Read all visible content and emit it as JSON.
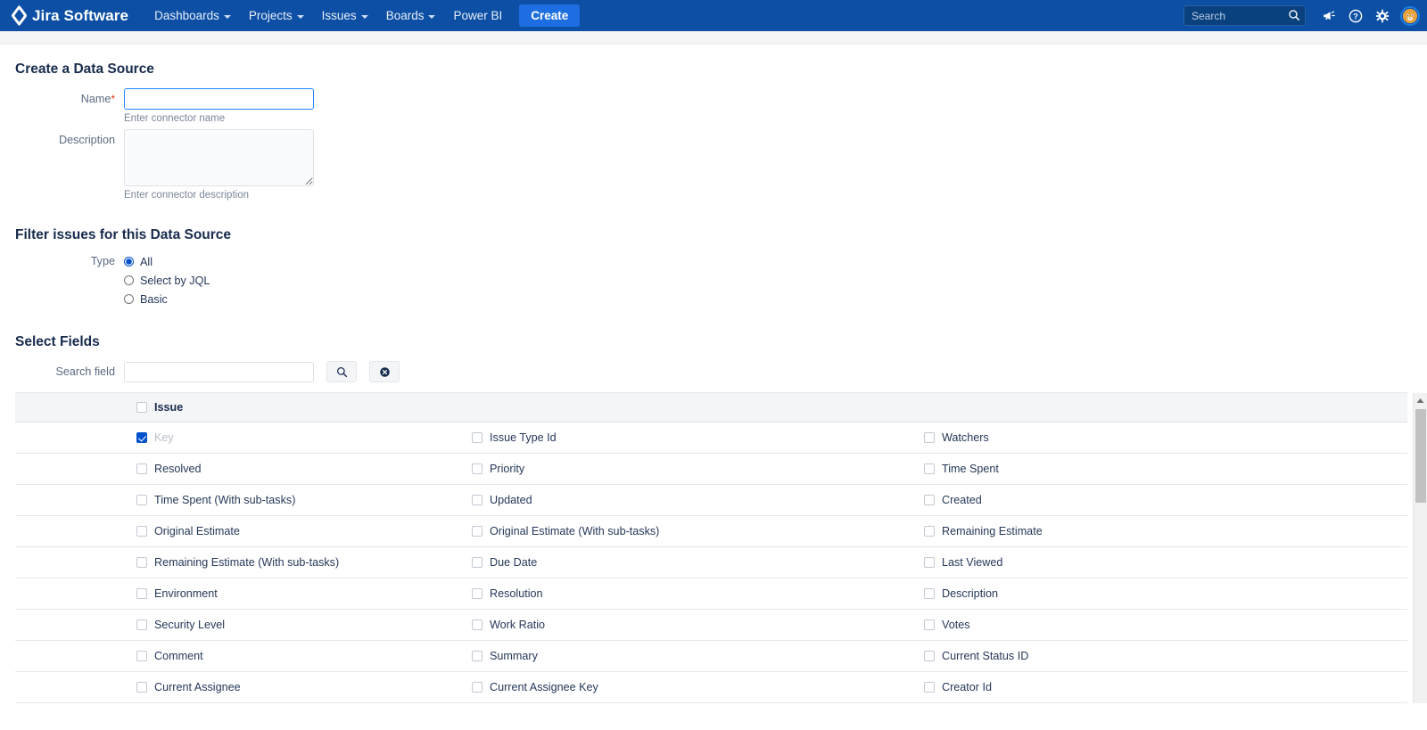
{
  "nav": {
    "brand": "Jira Software",
    "brand_icon": "jira-diamond-logo",
    "items": [
      {
        "label": "Dashboards",
        "caret": true
      },
      {
        "label": "Projects",
        "caret": true
      },
      {
        "label": "Issues",
        "caret": true
      },
      {
        "label": "Boards",
        "caret": true
      },
      {
        "label": "Power BI",
        "caret": false
      }
    ],
    "create_label": "Create",
    "search_placeholder": "Search",
    "search_value": "",
    "icons": [
      "search-icon",
      "megaphone-icon",
      "help-icon",
      "gear-icon",
      "avatar"
    ],
    "colors": {
      "nav_background": "#0c4fa5",
      "create_button": "#1d6ee0",
      "search_background": "#09417f"
    }
  },
  "page": {
    "title": "Create a Data Source",
    "name_label": "Name",
    "name_required_mark": "*",
    "name_value": "",
    "name_helper": "Enter connector name",
    "description_label": "Description",
    "description_value": "",
    "description_helper": "Enter connector description"
  },
  "filter": {
    "title": "Filter issues for this Data Source",
    "type_label": "Type",
    "options": [
      {
        "label": "All",
        "selected": true
      },
      {
        "label": "Select by JQL",
        "selected": false
      },
      {
        "label": "Basic",
        "selected": false
      }
    ]
  },
  "select_fields": {
    "title": "Select Fields",
    "search_label": "Search field",
    "search_value": "",
    "search_placeholder": "",
    "search_button_icon": "search-icon",
    "clear_button_icon": "clear-circle-icon",
    "group_header": {
      "label": "Issue",
      "checked": false
    },
    "rows": [
      [
        {
          "label": "Key",
          "checked": true,
          "muted": true
        },
        {
          "label": "Issue Type Id",
          "checked": false,
          "muted": false
        },
        {
          "label": "Watchers",
          "checked": false,
          "muted": false
        }
      ],
      [
        {
          "label": "Resolved",
          "checked": false,
          "muted": false
        },
        {
          "label": "Priority",
          "checked": false,
          "muted": false
        },
        {
          "label": "Time Spent",
          "checked": false,
          "muted": false
        }
      ],
      [
        {
          "label": "Time Spent (With sub-tasks)",
          "checked": false,
          "muted": false
        },
        {
          "label": "Updated",
          "checked": false,
          "muted": false
        },
        {
          "label": "Created",
          "checked": false,
          "muted": false
        }
      ],
      [
        {
          "label": "Original Estimate",
          "checked": false,
          "muted": false
        },
        {
          "label": "Original Estimate (With sub-tasks)",
          "checked": false,
          "muted": false
        },
        {
          "label": "Remaining Estimate",
          "checked": false,
          "muted": false
        }
      ],
      [
        {
          "label": "Remaining Estimate (With sub-tasks)",
          "checked": false,
          "muted": false
        },
        {
          "label": "Due Date",
          "checked": false,
          "muted": false
        },
        {
          "label": "Last Viewed",
          "checked": false,
          "muted": false
        }
      ],
      [
        {
          "label": "Environment",
          "checked": false,
          "muted": false
        },
        {
          "label": "Resolution",
          "checked": false,
          "muted": false
        },
        {
          "label": "Description",
          "checked": false,
          "muted": false
        }
      ],
      [
        {
          "label": "Security Level",
          "checked": false,
          "muted": false
        },
        {
          "label": "Work Ratio",
          "checked": false,
          "muted": false
        },
        {
          "label": "Votes",
          "checked": false,
          "muted": false
        }
      ],
      [
        {
          "label": "Comment",
          "checked": false,
          "muted": false
        },
        {
          "label": "Summary",
          "checked": false,
          "muted": false
        },
        {
          "label": "Current Status ID",
          "checked": false,
          "muted": false
        }
      ],
      [
        {
          "label": "Current Assignee",
          "checked": false,
          "muted": false
        },
        {
          "label": "Current Assignee Key",
          "checked": false,
          "muted": false
        },
        {
          "label": "Creator Id",
          "checked": false,
          "muted": false
        }
      ]
    ]
  }
}
